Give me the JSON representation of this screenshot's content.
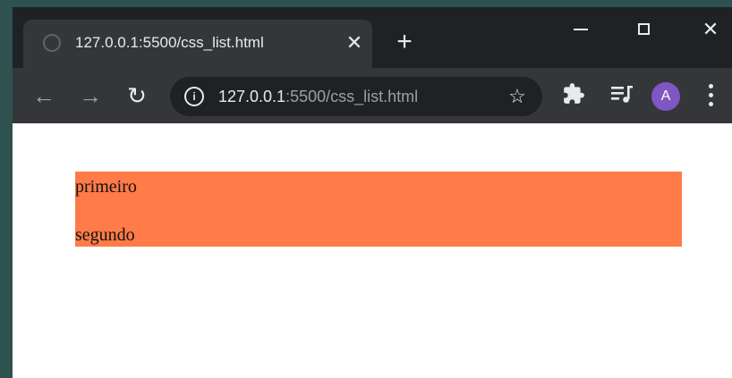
{
  "browser": {
    "tab": {
      "title": "127.0.0.1:5500/css_list.html",
      "close_glyph": "✕"
    },
    "new_tab_glyph": "+",
    "window_controls": {
      "close_glyph": "✕"
    },
    "toolbar": {
      "back_glyph": "←",
      "forward_glyph": "→",
      "reload_glyph": "↻",
      "url_host": "127.0.0.1",
      "url_rest": ":5500/css_list.html",
      "star_glyph": "☆",
      "avatar_letter": "A"
    }
  },
  "page": {
    "list_background": "#ff7b48",
    "items": [
      "primeiro",
      "segundo"
    ]
  }
}
